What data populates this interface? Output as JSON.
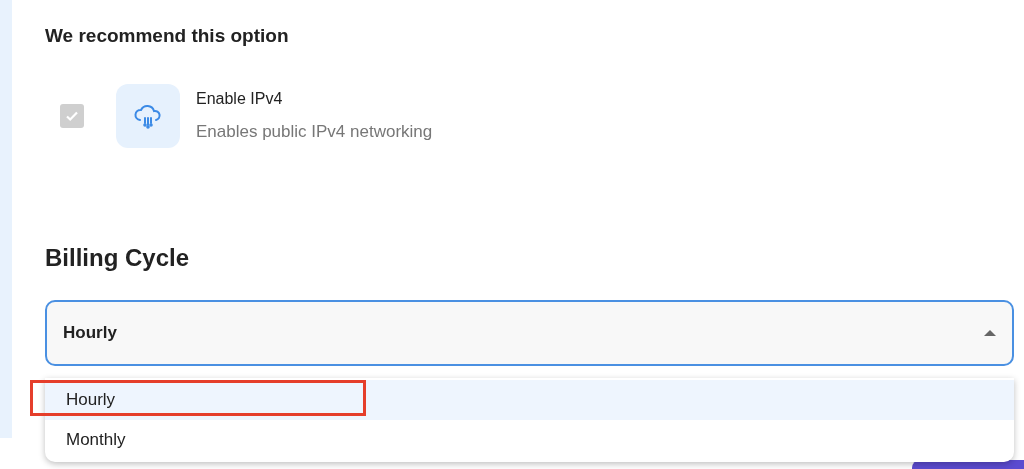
{
  "recommendation": {
    "heading": "We recommend this option"
  },
  "option": {
    "checked": true,
    "disabled": true,
    "title": "Enable IPv4",
    "description": "Enables public IPv4 networking"
  },
  "billing": {
    "heading": "Billing Cycle",
    "value": "Hourly",
    "expanded": true,
    "options": [
      {
        "label": "Hourly",
        "selected": true,
        "highlighted": true
      },
      {
        "label": "Monthly",
        "selected": false,
        "highlighted": false
      }
    ]
  }
}
